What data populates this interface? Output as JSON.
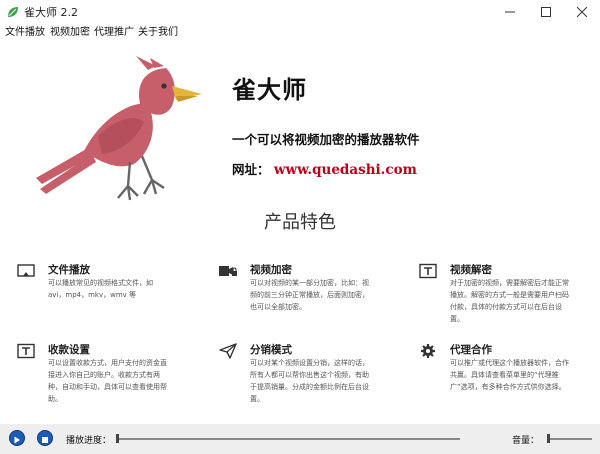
{
  "window": {
    "title": "雀大师 2.2",
    "minimize_icon": "minimize-icon",
    "maximize_icon": "maximize-icon",
    "close_icon": "close-icon",
    "app_icon": "leaf-icon",
    "accent": "#3aa24a"
  },
  "menu": [
    {
      "label": "文件播放"
    },
    {
      "label": "视频加密"
    },
    {
      "label": "代理推广"
    },
    {
      "label": "关于我们"
    }
  ],
  "hero": {
    "brand": "雀大师",
    "tagline": "一个可以将视频加密的播放器软件",
    "site_label": "网址：",
    "site_url": "www.quedashi.com",
    "bird_color": "#c75f6b",
    "url_color": "#c0001a"
  },
  "section_title": "产品特色",
  "features": [
    {
      "icon": "cast-icon",
      "title": "文件播放",
      "desc": "可以播放常见的视频格式文件，如avi，mp4，mkv，wmv 等"
    },
    {
      "icon": "video-lock-icon",
      "title": "视频加密",
      "desc": "可以对视频的某一部分加密，比如：视频的前三分钟正常播放，后面则加密，也可以全部加密。"
    },
    {
      "icon": "text-box-icon",
      "title": "视频解密",
      "desc": "对于加密的视频，需要解密后才能正常播放。解密的方式一般是需要用户扫码付款，具体的付款方式可以在后台设置。"
    },
    {
      "icon": "text-box-icon",
      "title": "收款设置",
      "desc": "可以设置收款方式，用户支付的资金直接进入你自己的账户。收款方式有两种，自动和手动，具体可以查看使用帮助。"
    },
    {
      "icon": "send-icon",
      "title": "分销模式",
      "desc": "可以对某个视频设置分销，这样的话，所有人都可以帮你出售这个视频，有助于提高销量。分成的金额比例在后台设置。"
    },
    {
      "icon": "gear-icon",
      "title": "代理合作",
      "desc": "可以推广或代理这个播放器软件，合作共赢。具体请查看菜单里的“代理推广”选项，有多种合作方式供你选择。"
    }
  ],
  "player": {
    "play_icon": "play-icon",
    "stop_icon": "stop-icon",
    "progress_label": "播放进度：",
    "volume_label": "音量：",
    "progress": 0.0,
    "volume": 0.0
  }
}
